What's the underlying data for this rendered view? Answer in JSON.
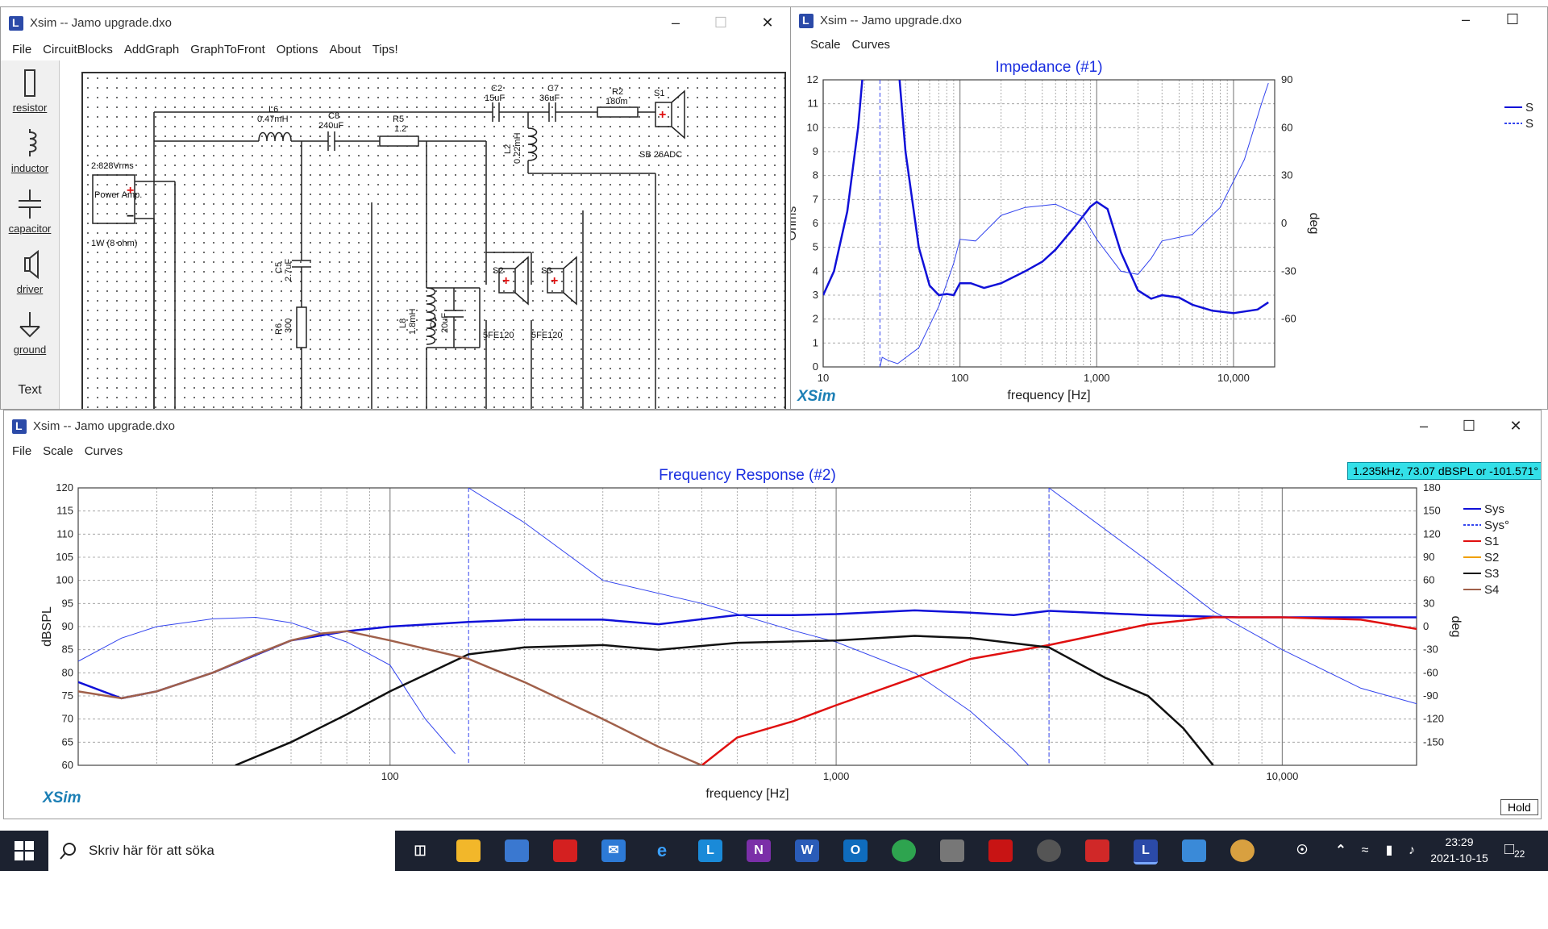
{
  "circuit_window": {
    "title": "Xsim -- Jamo upgrade.dxo",
    "menu": [
      "File",
      "CircuitBlocks",
      "AddGraph",
      "GraphToFront",
      "Options",
      "About",
      "Tips!"
    ],
    "tools": [
      "resistor",
      "inductor",
      "capacitor",
      "driver",
      "ground",
      "Text"
    ],
    "components": {
      "source_voltage": "2.828Vrms",
      "source_name": "Power Amp.",
      "source_load": "1W (8 ohm)",
      "L6": [
        "L6",
        "0.47mH"
      ],
      "C8": [
        "C8",
        "240uF"
      ],
      "R5": [
        "R5",
        "1.2"
      ],
      "C2": [
        "C2",
        "15uF"
      ],
      "C7": [
        "C7",
        "36uF"
      ],
      "R2": [
        "R2",
        "180m"
      ],
      "S1": [
        "S1",
        "SB 26ADC"
      ],
      "L2": [
        "L2",
        "0.22mH"
      ],
      "C5": [
        "C5",
        "2.7uF"
      ],
      "R6": [
        "R6",
        "300"
      ],
      "L8": [
        "L8",
        "1.8mH"
      ],
      "C1": [
        "C1",
        "20uF"
      ],
      "S2": [
        "S2",
        "5FE120"
      ],
      "S3": [
        "S3",
        "5FE120"
      ]
    }
  },
  "impedance_window": {
    "title": "Xsim -- Jamo upgrade.dxo",
    "menu": [
      "Scale",
      "Curves"
    ],
    "logo": "XSim"
  },
  "freq_window": {
    "title": "Xsim -- Jamo upgrade.dxo",
    "menu": [
      "File",
      "Scale",
      "Curves"
    ],
    "logo": "XSim",
    "cursor_readout": "1.235kHz, 73.07 dBSPL or -101.571°",
    "hold_label": "Hold"
  },
  "chart_data": [
    {
      "type": "line",
      "title": "Impedance (#1)",
      "xlabel": "frequency [Hz]",
      "ylabel": "Ohms",
      "y2label": "deg",
      "xscale": "log",
      "xlim": [
        10,
        20000
      ],
      "ylim": [
        0,
        12
      ],
      "y2lim": [
        -90,
        90
      ],
      "x_ticks": [
        "10",
        "100",
        "1,000",
        "10,000"
      ],
      "y_ticks": [
        "0",
        "1",
        "2",
        "3",
        "4",
        "5",
        "6",
        "7",
        "8",
        "9",
        "10",
        "11",
        "12"
      ],
      "y2_ticks": [
        "90",
        "60",
        "30",
        "0",
        "-30",
        "-60"
      ],
      "legend": [
        "S",
        "S"
      ],
      "series": [
        {
          "name": "S",
          "axis": "left",
          "color": "#1010d8",
          "width": 2.5,
          "points": [
            [
              10,
              3
            ],
            [
              12,
              4
            ],
            [
              15,
              6.5
            ],
            [
              18,
              10
            ],
            [
              20,
              13
            ],
            [
              35,
              13
            ],
            [
              40,
              9
            ],
            [
              50,
              5
            ],
            [
              60,
              3.4
            ],
            [
              70,
              3
            ],
            [
              80,
              3.05
            ],
            [
              90,
              3
            ],
            [
              100,
              3.5
            ],
            [
              120,
              3.5
            ],
            [
              150,
              3.3
            ],
            [
              200,
              3.5
            ],
            [
              300,
              4
            ],
            [
              400,
              4.4
            ],
            [
              500,
              4.9
            ],
            [
              700,
              5.9
            ],
            [
              900,
              6.7
            ],
            [
              1000,
              6.9
            ],
            [
              1200,
              6.6
            ],
            [
              1500,
              4.8
            ],
            [
              2000,
              3.2
            ],
            [
              2500,
              2.85
            ],
            [
              3000,
              3
            ],
            [
              4000,
              2.9
            ],
            [
              5000,
              2.6
            ],
            [
              7000,
              2.35
            ],
            [
              10000,
              2.25
            ],
            [
              15000,
              2.4
            ],
            [
              18000,
              2.7
            ]
          ]
        },
        {
          "name": "S",
          "axis": "right",
          "color": "#3344ee",
          "width": 1,
          "dashed_vertical_x": 26,
          "points": [
            [
              26,
              -90
            ],
            [
              27,
              -84
            ],
            [
              30,
              -86
            ],
            [
              35,
              -88
            ],
            [
              50,
              -78
            ],
            [
              70,
              -52
            ],
            [
              90,
              -25
            ],
            [
              100,
              -10
            ],
            [
              130,
              -11
            ],
            [
              200,
              5
            ],
            [
              300,
              10
            ],
            [
              500,
              12
            ],
            [
              800,
              4
            ],
            [
              1000,
              -10
            ],
            [
              1500,
              -30
            ],
            [
              2000,
              -32
            ],
            [
              2500,
              -22
            ],
            [
              3000,
              -11
            ],
            [
              5000,
              -7
            ],
            [
              8000,
              10
            ],
            [
              12000,
              40
            ],
            [
              16000,
              75
            ],
            [
              18000,
              88
            ]
          ]
        }
      ]
    },
    {
      "type": "line",
      "title": "Frequency Response (#2)",
      "xlabel": "frequency [Hz]",
      "ylabel": "dBSPL",
      "y2label": "deg",
      "xscale": "log",
      "xlim": [
        20,
        20000
      ],
      "ylim": [
        60,
        120
      ],
      "y2lim": [
        -180,
        180
      ],
      "x_ticks": [
        "100",
        "1,000",
        "10,000"
      ],
      "y_ticks": [
        "120",
        "115",
        "110",
        "105",
        "100",
        "95",
        "90",
        "85",
        "80",
        "75",
        "70",
        "65",
        "60"
      ],
      "y2_ticks": [
        "180",
        "150",
        "120",
        "90",
        "60",
        "30",
        "0",
        "-30",
        "-60",
        "-90",
        "-120",
        "-150"
      ],
      "legend": [
        "Sys",
        "Sys°",
        "S1",
        "S2",
        "S3",
        "S4"
      ],
      "series": [
        {
          "name": "Sys",
          "axis": "left",
          "color": "#1010d8",
          "width": 2.5,
          "points": [
            [
              20,
              78
            ],
            [
              25,
              74.5
            ],
            [
              30,
              76
            ],
            [
              40,
              80
            ],
            [
              60,
              87
            ],
            [
              80,
              89
            ],
            [
              100,
              90
            ],
            [
              150,
              91
            ],
            [
              200,
              91.5
            ],
            [
              300,
              91.5
            ],
            [
              400,
              90.5
            ],
            [
              600,
              92.5
            ],
            [
              800,
              92.5
            ],
            [
              1000,
              92.7
            ],
            [
              1500,
              93.5
            ],
            [
              2000,
              93
            ],
            [
              2500,
              92.5
            ],
            [
              3000,
              93.4
            ],
            [
              5000,
              92.5
            ],
            [
              8000,
              92
            ],
            [
              10000,
              92
            ],
            [
              15000,
              92
            ],
            [
              20000,
              92
            ]
          ]
        },
        {
          "name": "Sys°",
          "axis": "right",
          "color": "#3344ee",
          "width": 1,
          "points": [
            [
              20,
              -45
            ],
            [
              25,
              -15
            ],
            [
              30,
              0
            ],
            [
              40,
              10
            ],
            [
              50,
              12
            ],
            [
              60,
              5
            ],
            [
              80,
              -20
            ],
            [
              100,
              -50
            ],
            [
              120,
              -120
            ],
            [
              140,
              -165
            ],
            [
              150,
              180
            ],
            [
              200,
              135
            ],
            [
              300,
              60
            ],
            [
              500,
              30
            ],
            [
              800,
              -5
            ],
            [
              1000,
              -20
            ],
            [
              1500,
              -60
            ],
            [
              2000,
              -110
            ],
            [
              2500,
              -160
            ],
            [
              2700,
              -180
            ],
            [
              3000,
              180
            ],
            [
              5000,
              85
            ],
            [
              7000,
              20
            ],
            [
              10000,
              -30
            ],
            [
              15000,
              -80
            ],
            [
              20000,
              -100
            ]
          ]
        },
        {
          "name": "S1",
          "axis": "left",
          "color": "#e01010",
          "width": 2.5,
          "points": [
            [
              500,
              60
            ],
            [
              600,
              66
            ],
            [
              800,
              69.5
            ],
            [
              1000,
              73
            ],
            [
              1500,
              79
            ],
            [
              2000,
              83
            ],
            [
              3000,
              86
            ],
            [
              5000,
              90.5
            ],
            [
              7000,
              92
            ],
            [
              10000,
              92
            ],
            [
              15000,
              91.5
            ],
            [
              20000,
              89.5
            ]
          ]
        },
        {
          "name": "S2",
          "axis": "left",
          "color": "#f0a000",
          "width": 1.5,
          "points": [
            [
              20,
              76
            ],
            [
              25,
              74.5
            ],
            [
              30,
              76
            ],
            [
              40,
              80
            ],
            [
              50,
              84
            ],
            [
              60,
              87
            ],
            [
              70,
              88.5
            ],
            [
              80,
              89
            ],
            [
              100,
              87
            ],
            [
              150,
              83
            ],
            [
              200,
              78
            ],
            [
              300,
              70
            ],
            [
              400,
              64
            ],
            [
              500,
              60
            ]
          ]
        },
        {
          "name": "S3",
          "axis": "left",
          "color": "#111111",
          "width": 2.5,
          "points": [
            [
              45,
              60
            ],
            [
              60,
              65
            ],
            [
              80,
              71
            ],
            [
              100,
              76
            ],
            [
              150,
              84
            ],
            [
              200,
              85.5
            ],
            [
              300,
              86
            ],
            [
              400,
              85
            ],
            [
              600,
              86.5
            ],
            [
              1000,
              87
            ],
            [
              1500,
              88
            ],
            [
              2000,
              87.5
            ],
            [
              3000,
              85.5
            ],
            [
              4000,
              79
            ],
            [
              5000,
              75
            ],
            [
              6000,
              68
            ],
            [
              7000,
              60
            ]
          ]
        },
        {
          "name": "S4",
          "axis": "left",
          "color": "#a0604a",
          "width": 2.5,
          "points": [
            [
              20,
              76
            ],
            [
              25,
              74.5
            ],
            [
              30,
              76
            ],
            [
              40,
              80
            ],
            [
              50,
              84
            ],
            [
              60,
              87
            ],
            [
              70,
              88.5
            ],
            [
              80,
              89
            ],
            [
              100,
              87
            ],
            [
              150,
              83
            ],
            [
              200,
              78
            ],
            [
              300,
              70
            ],
            [
              400,
              64
            ],
            [
              500,
              60
            ]
          ]
        }
      ]
    }
  ],
  "taskbar": {
    "search_placeholder": "Skriv här för att söka",
    "time": "23:29",
    "date": "2021-10-15",
    "notifications": "22"
  }
}
